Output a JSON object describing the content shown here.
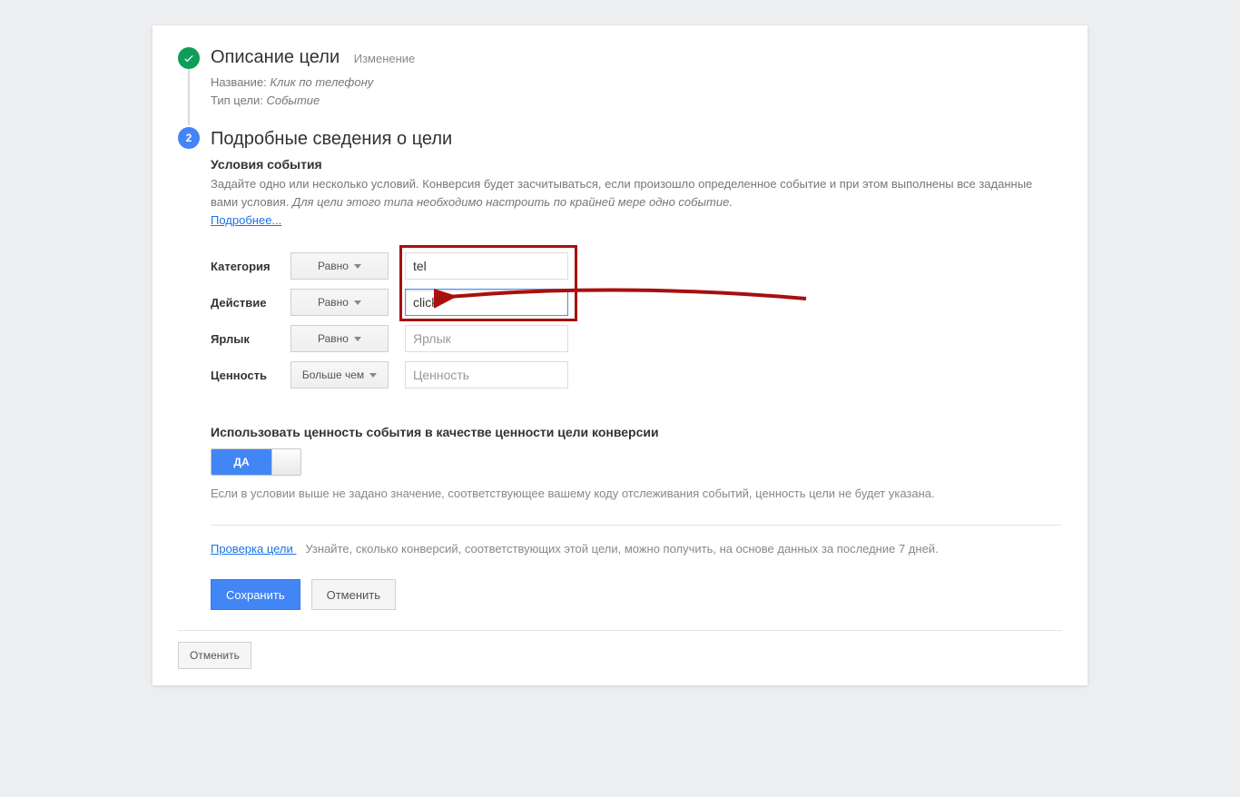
{
  "step1": {
    "title": "Описание цели",
    "sub": "Изменение",
    "name_label": "Название:",
    "name_value": "Клик по телефону",
    "type_label": "Тип цели:",
    "type_value": "Событие"
  },
  "step2": {
    "number": "2",
    "title": "Подробные сведения о цели",
    "section": "Условия события",
    "desc_plain": "Задайте одно или несколько условий. Конверсия будет засчитываться, если произошло определенное событие и при этом выполнены все заданные вами условия.",
    "desc_italic": "Для цели этого типа необходимо настроить по крайней мере одно событие.",
    "learn_more": "Подробнее..."
  },
  "conditions": [
    {
      "label": "Категория",
      "operator": "Равно",
      "value": "tel",
      "placeholder": ""
    },
    {
      "label": "Действие",
      "operator": "Равно",
      "value": "click",
      "placeholder": ""
    },
    {
      "label": "Ярлык",
      "operator": "Равно",
      "value": "",
      "placeholder": "Ярлык"
    },
    {
      "label": "Ценность",
      "operator": "Больше чем",
      "value": "",
      "placeholder": "Ценность"
    }
  ],
  "value_section": {
    "title": "Использовать ценность события в качестве ценности цели конверсии",
    "toggle_on": "ДА",
    "note": "Если в условии выше не задано значение, соответствующее вашему коду отслеживания событий, ценность цели не будет указана."
  },
  "verify": {
    "link": "Проверка цели ",
    "text": "Узнайте, сколько конверсий, соответствующих этой цели, можно получить, на основе данных за последние 7 дней."
  },
  "buttons": {
    "save": "Сохранить",
    "cancel_inner": "Отменить",
    "cancel_outer": "Отменить"
  }
}
